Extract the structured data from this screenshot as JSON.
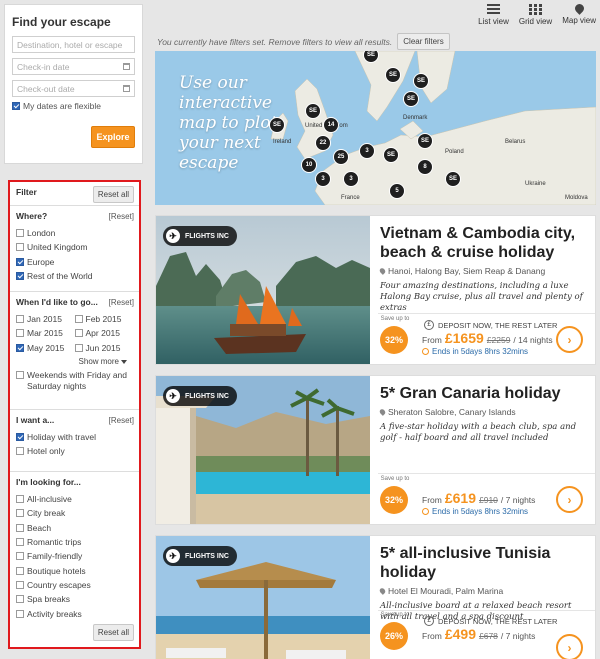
{
  "search": {
    "title": "Find your escape",
    "destination_placeholder": "Destination, hotel or escape",
    "checkin_placeholder": "Check-in date",
    "checkout_placeholder": "Check-out date",
    "flexible_label": "My dates are flexible",
    "flexible_checked": true,
    "explore_label": "Explore"
  },
  "filter": {
    "title": "Filter",
    "reset_all": "Reset all",
    "reset": "[Reset]",
    "where": {
      "heading": "Where?",
      "options": [
        {
          "label": "London",
          "checked": false
        },
        {
          "label": "United Kingdom",
          "checked": false
        },
        {
          "label": "Europe",
          "checked": true
        },
        {
          "label": "Rest of the World",
          "checked": true
        }
      ]
    },
    "when": {
      "heading": "When I'd like to go...",
      "months": [
        {
          "label": "Jan 2015",
          "checked": false
        },
        {
          "label": "Feb 2015",
          "checked": false
        },
        {
          "label": "Mar 2015",
          "checked": false
        },
        {
          "label": "Apr 2015",
          "checked": false
        },
        {
          "label": "May 2015",
          "checked": true
        },
        {
          "label": "Jun 2015",
          "checked": false
        }
      ],
      "show_more": "Show more",
      "weekends_label": "Weekends with Friday and Saturday nights",
      "weekends_checked": false
    },
    "want": {
      "heading": "I want a...",
      "options": [
        {
          "label": "Holiday with travel",
          "checked": true
        },
        {
          "label": "Hotel only",
          "checked": false
        }
      ]
    },
    "looking": {
      "heading": "I'm looking for...",
      "options": [
        {
          "label": "All-inclusive",
          "checked": false
        },
        {
          "label": "City break",
          "checked": false
        },
        {
          "label": "Beach",
          "checked": false
        },
        {
          "label": "Romantic trips",
          "checked": false
        },
        {
          "label": "Family-friendly",
          "checked": false
        },
        {
          "label": "Boutique hotels",
          "checked": false
        },
        {
          "label": "Country escapes",
          "checked": false
        },
        {
          "label": "Spa breaks",
          "checked": false
        },
        {
          "label": "Activity breaks",
          "checked": false
        }
      ],
      "reset_all": "Reset all"
    }
  },
  "views": {
    "list": "List view",
    "grid": "Grid view",
    "map": "Map view"
  },
  "notice": {
    "text": "You currently have filters set. Remove filters to view all results.",
    "clear_label": "Clear filters"
  },
  "map_banner": {
    "text": "Use our interactive map to plot your next escape",
    "place_labels": [
      "Ireland",
      "United Kingdom",
      "Denmark",
      "Poland",
      "Belarus",
      "Ukraine",
      "France",
      "Moldova"
    ],
    "cluster_counts": [
      "14",
      "22",
      "25",
      "10",
      "3",
      "3",
      "3",
      "8",
      "5"
    ]
  },
  "cards": [
    {
      "badge": "FLIGHTS INC",
      "title": "Vietnam & Cambodia city, beach & cruise holiday",
      "location": "Hanoi, Halong Bay, Siem Reap & Danang",
      "description": "Four amazing destinations, including a luxe Halong Bay cruise, plus all travel and plenty of extras",
      "save_label": "Save up to",
      "save_pct": "32%",
      "deposit": "DEPOSIT NOW, THE REST LATER",
      "from": "From",
      "price": "£1659",
      "was": "£2259",
      "nights": "/ 14 nights",
      "ends": "Ends in 5days 8hrs 32mins"
    },
    {
      "badge": "FLIGHTS INC",
      "title": "5* Gran Canaria holiday",
      "location": "Sheraton Salobre, Canary Islands",
      "description": "A five-star holiday with a beach club, spa and golf - half board and all travel included",
      "save_label": "Save up to",
      "save_pct": "32%",
      "deposit": "",
      "from": "From",
      "price": "£619",
      "was": "£910",
      "nights": "/ 7 nights",
      "ends": "Ends in 5days 8hrs 32mins"
    },
    {
      "badge": "FLIGHTS INC",
      "title": "5* all-inclusive Tunisia holiday",
      "location": "Hotel El Mouradi, Palm Marina",
      "description": "All-inclusive board at a relaxed beach resort with all travel and a spa discount",
      "save_label": "Save up to",
      "save_pct": "26%",
      "deposit": "DEPOSIT NOW, THE REST LATER",
      "from": "From",
      "price": "£499",
      "was": "£678",
      "nights": "/ 7 nights"
    }
  ],
  "colors": {
    "accent": "#f5931f",
    "filter_border": "#e0191d",
    "checkbox": "#2f67b7"
  }
}
